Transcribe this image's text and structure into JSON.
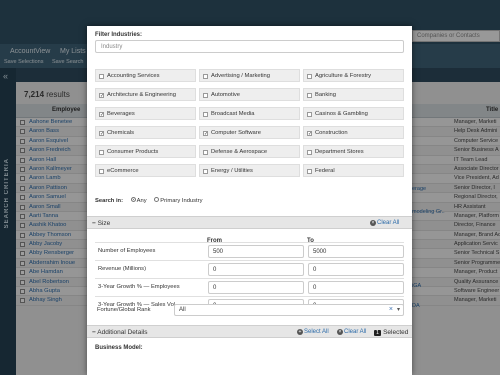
{
  "app": {
    "nav": {
      "account_view": "AccountView",
      "my_lists": "My Lists",
      "save_selections": "Save Selections",
      "save_search": "Save Search"
    },
    "search_placeholder": "Companies or Contacts",
    "left_rail_label": "SEARCH CRITERIA",
    "results_count": "7,214",
    "results_label": "results",
    "columns": {
      "employee": "Employee",
      "title": "Title"
    },
    "employees": [
      "Aahone Benetee",
      "Aaron Bass",
      "Aaron Esquivel",
      "Aaron Fredreich",
      "Aaron Hall",
      "Aaron Kallmeyer",
      "Aaron Lamb",
      "Aaron Pattison",
      "Aaron Samuel",
      "Aaron Small",
      "Aarti Tanna",
      "Aashik Khatoo",
      "Abbey Thomson",
      "Abby Jacoby",
      "Abby Rensberger",
      "Abderrahim Inoue",
      "Abe Hamdan",
      "Abel Robertson",
      "Abha Gupta",
      "Abhay Singh"
    ],
    "titles": [
      "Manager, Marketi",
      "Help Desk Admini",
      "Computer Service",
      "Senior Business A",
      "IT Team Lead",
      "Associate Director",
      "Vice President, Ad",
      "Senior Director, I",
      "Regional Director,",
      "HR Assistant",
      "Manager, Platform",
      "Director, Finance",
      "Manager, Brand Ac",
      "Application Servic",
      "Senior Technical S",
      "Senior Programme",
      "Manager, Product",
      "Quality Assurance",
      "Software Engineer",
      "Manager, Marketi"
    ],
    "mid_links": [
      "erage",
      "modeling Gr..",
      "iGA",
      "DA"
    ]
  },
  "modal": {
    "filter_label": "Filter Industries:",
    "filter_placeholder": "Industry",
    "industries": [
      {
        "label": "Accounting Services",
        "checked": false
      },
      {
        "label": "Advertising / Marketing",
        "checked": false
      },
      {
        "label": "Agriculture & Forestry",
        "checked": false
      },
      {
        "label": "Architecture & Engineering",
        "checked": true
      },
      {
        "label": "Automotive",
        "checked": false
      },
      {
        "label": "Banking",
        "checked": false
      },
      {
        "label": "Beverages",
        "checked": true
      },
      {
        "label": "Broadcast Media",
        "checked": false
      },
      {
        "label": "Casinos & Gambling",
        "checked": false
      },
      {
        "label": "Chemicals",
        "checked": true
      },
      {
        "label": "Computer Software",
        "checked": true
      },
      {
        "label": "Construction",
        "checked": true
      },
      {
        "label": "Consumer Products",
        "checked": false
      },
      {
        "label": "Defense & Aerospace",
        "checked": false
      },
      {
        "label": "Department Stores",
        "checked": false
      },
      {
        "label": "eCommerce",
        "checked": false
      },
      {
        "label": "Energy / Utilities",
        "checked": false
      },
      {
        "label": "Federal",
        "checked": false
      }
    ],
    "search_in": {
      "label": "Search in:",
      "options": [
        "Any",
        "Primary Industry"
      ],
      "selected": "Any"
    },
    "size_section": {
      "title": "Size",
      "clear_all": "Clear All",
      "col_from": "From",
      "col_to": "To",
      "rows": [
        {
          "label": "Number of Employees",
          "from": "500",
          "to": "5000"
        },
        {
          "label": "Revenue (Millions)",
          "from": "0",
          "to": "0"
        },
        {
          "label": "3-Year Growth % — Employees",
          "from": "0",
          "to": "0"
        },
        {
          "label": "3-Year Growth % — Sales Vol",
          "from": "0",
          "to": "0"
        }
      ],
      "rank_label": "Fortune/Global Rank",
      "rank_value": "All"
    },
    "additional_section": {
      "title": "Additional Details",
      "select_all": "Select All",
      "clear_all": "Clear All",
      "selected_count": "1",
      "selected_label": "Selected"
    },
    "business_model_label": "Business Model:"
  }
}
